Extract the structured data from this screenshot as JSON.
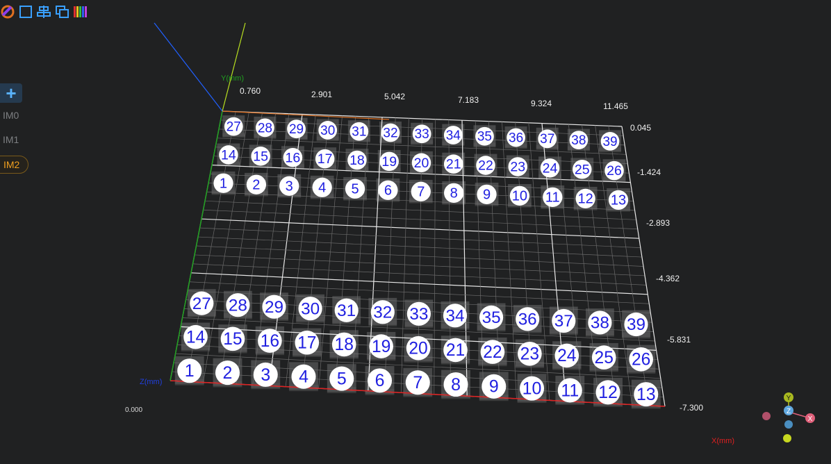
{
  "toolbar": {
    "items": [
      {
        "icon": "logo-ring-icon"
      },
      {
        "icon": "select-box-icon"
      },
      {
        "icon": "align-icon"
      },
      {
        "icon": "layers-copy-icon"
      },
      {
        "icon": "color-bars-icon"
      }
    ]
  },
  "layers": {
    "add_label": "+",
    "items": [
      {
        "label": "IM0",
        "active": false
      },
      {
        "label": "IM1",
        "active": false
      },
      {
        "label": "IM2",
        "active": true
      }
    ]
  },
  "axes": {
    "x_title": "X(mm)",
    "y_title": "Y(mm)",
    "z_title": "Z(mm)",
    "x_ticks": [
      "0.760",
      "2.901",
      "5.042",
      "7.183",
      "9.324",
      "11.465"
    ],
    "y_ticks": [
      "0.045",
      "-1.424",
      "-2.893",
      "-4.362",
      "-5.831",
      "-7.300"
    ],
    "corner_readout": "0.000"
  },
  "markers": {
    "top_rows": [
      [
        "27",
        "28",
        "29",
        "30",
        "31",
        "32",
        "33",
        "34",
        "35",
        "36",
        "37",
        "38",
        "39"
      ],
      [
        "14",
        "15",
        "16",
        "17",
        "18",
        "19",
        "20",
        "21",
        "22",
        "23",
        "24",
        "25",
        "26"
      ],
      [
        "1",
        "2",
        "3",
        "4",
        "5",
        "6",
        "7",
        "8",
        "9",
        "10",
        "11",
        "12",
        "13"
      ]
    ],
    "bottom_rows": [
      [
        "27",
        "28",
        "29",
        "30",
        "31",
        "32",
        "33",
        "34",
        "35",
        "36",
        "37",
        "38",
        "39"
      ],
      [
        "14",
        "15",
        "16",
        "17",
        "18",
        "19",
        "20",
        "21",
        "22",
        "23",
        "24",
        "25",
        "26"
      ],
      [
        "1",
        "2",
        "3",
        "4",
        "5",
        "6",
        "7",
        "8",
        "9",
        "10",
        "11",
        "12",
        "13"
      ]
    ]
  },
  "gizmo": {
    "y_label": "Y",
    "z_label": "Z",
    "x_label": "X"
  },
  "colors": {
    "marker_text": "#2020e0",
    "x_axis": "#e02020",
    "y_axis": "#20a020",
    "z_axis": "#2060ff",
    "accent": "#f0a020"
  }
}
